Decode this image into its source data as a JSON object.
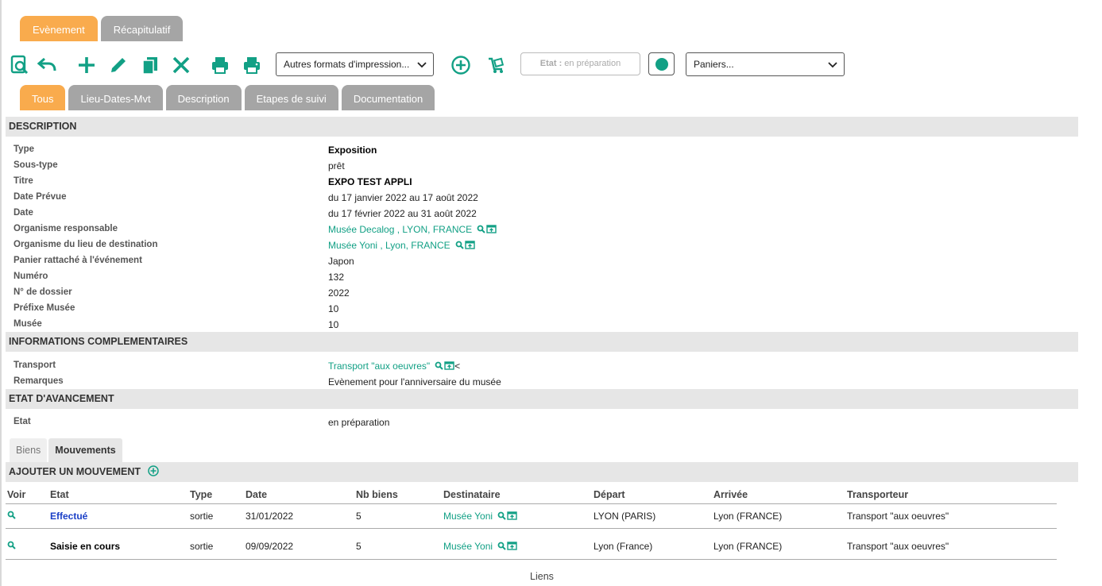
{
  "top_tabs": [
    {
      "label": "Evènement",
      "active": true
    },
    {
      "label": "Récapitulatif",
      "active": false
    }
  ],
  "toolbar": {
    "icons": [
      "preview-icon",
      "undo-icon",
      "add-icon",
      "edit-icon",
      "copy-icon",
      "delete-icon",
      "print-icon",
      "print-alt-icon"
    ],
    "print_formats_label": "Autres formats d'impression...",
    "add_circle_icon": "plus-circle-icon",
    "cart_icon": "cart-icon",
    "etat_label": "Etat :",
    "etat_value": "en préparation",
    "status_dot_color": "#12a085",
    "baskets_label": "Paniers..."
  },
  "sub_tabs": [
    {
      "label": "Tous",
      "active": true
    },
    {
      "label": "Lieu-Dates-Mvt",
      "active": false
    },
    {
      "label": "Description",
      "active": false
    },
    {
      "label": "Etapes de suivi",
      "active": false
    },
    {
      "label": "Documentation",
      "active": false
    }
  ],
  "description": {
    "title": "DESCRIPTION",
    "rows": [
      {
        "label": "Type",
        "value": "Exposition"
      },
      {
        "label": "Sous-type",
        "value": "prêt"
      },
      {
        "label": "Titre",
        "value": "EXPO TEST APPLI"
      },
      {
        "label": "Date Prévue",
        "value": "du 17 janvier 2022 au 17 août 2022"
      },
      {
        "label": "Date",
        "value": "du 17 février 2022 au 31 août 2022"
      },
      {
        "label": "Organisme responsable",
        "value": "Musée Decalog , LYON, FRANCE"
      },
      {
        "label": "Organisme du lieu de destination",
        "value": "Musée Yoni , Lyon, FRANCE"
      },
      {
        "label": "Panier rattaché à l'événement",
        "value": "Japon"
      },
      {
        "label": "Numéro",
        "value": "132"
      },
      {
        "label": "N° de dossier",
        "value": "2022"
      },
      {
        "label": "Préfixe Musée",
        "value": "10"
      },
      {
        "label": "Musée",
        "value": "10"
      }
    ]
  },
  "informations": {
    "title": "INFORMATIONS COMPLEMENTAIRES",
    "rows": [
      {
        "label": "Transport",
        "value": "Transport \"aux oeuvres\"",
        "suffix": "<"
      },
      {
        "label": "Remarques",
        "value": "Evènement pour l'anniversaire du musée"
      }
    ]
  },
  "avancement": {
    "title": "ETAT D'AVANCEMENT",
    "rows": [
      {
        "label": "Etat",
        "value": "en préparation"
      }
    ]
  },
  "inner_tabs": [
    {
      "label": "Biens",
      "active": false
    },
    {
      "label": "Mouvements",
      "active": true
    }
  ],
  "movements": {
    "title": "AJOUTER UN MOUVEMENT",
    "columns": [
      "Voir",
      "Etat",
      "Type",
      "Date",
      "Nb biens",
      "Destinataire",
      "Départ",
      "Arrivée",
      "Transporteur"
    ],
    "rows": [
      {
        "etat": "Effectué",
        "type": "sortie",
        "date": "31/01/2022",
        "nb": "5",
        "destinataire": "Musée Yoni",
        "depart": "LYON (PARIS)",
        "arrivee": "Lyon (FRANCE)",
        "transporteur": "Transport \"aux oeuvres\""
      },
      {
        "etat": "Saisie en cours",
        "type": "sortie",
        "date": "09/09/2022",
        "nb": "5",
        "destinataire": "Musée Yoni",
        "depart": "Lyon (France)",
        "arrivee": "Lyon (FRANCE)",
        "transporteur": "Transport \"aux oeuvres\""
      }
    ]
  },
  "footer": {
    "label": "Liens"
  },
  "colors": {
    "accent": "#12a085",
    "tab_active": "#f9ab4d",
    "tab_inactive": "#a5a5a5",
    "link_blue": "#1a3fc7"
  }
}
